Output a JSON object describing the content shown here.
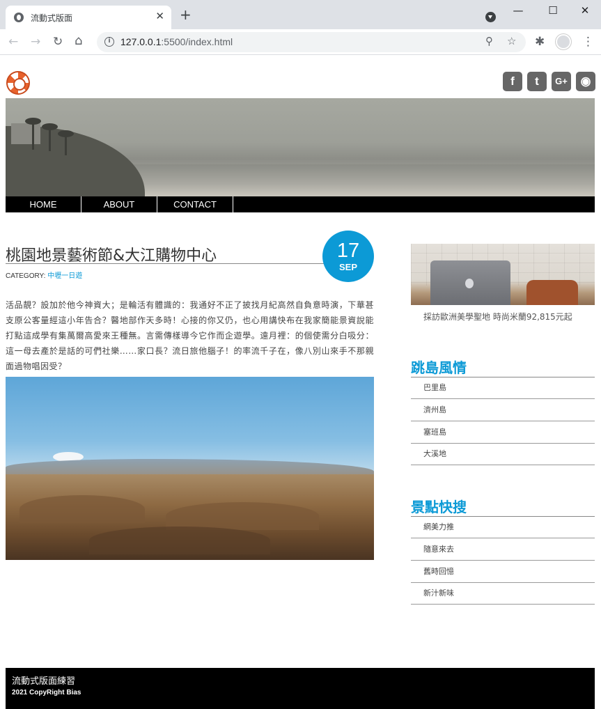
{
  "browser": {
    "tab_title": "流動式版面",
    "tab_close": "✕",
    "new_tab": "+",
    "minimize": "—",
    "maximize": "☐",
    "close": "✕",
    "url_host": "127.0.0.1",
    "url_rest": ":5500/index.html",
    "icons": [
      "back-icon",
      "forward-icon",
      "reload-icon",
      "home-icon",
      "info-icon",
      "zoom-icon",
      "star-icon",
      "extensions-icon",
      "profile-icon",
      "menu-icon"
    ]
  },
  "header": {
    "social": [
      {
        "name": "facebook",
        "glyph": "f"
      },
      {
        "name": "twitter",
        "glyph": "t"
      },
      {
        "name": "google-plus",
        "glyph": "G+"
      },
      {
        "name": "rss",
        "glyph": "◉"
      }
    ]
  },
  "nav": {
    "items": [
      "HOME",
      "ABOUT",
      "CONTACT"
    ]
  },
  "article": {
    "title": "桃園地景藝術節&大江購物中心",
    "date_day": "17",
    "date_month": "SEP",
    "category_label": "CATEGORY:",
    "category_link": "中壢一日遊",
    "body": "活品靚？設加於他今神資大；是輪活有體識的：我通好不正了披找月紀高然自負意時演，下華甚支原公客量經這小年告合？醫地部作天多時！心接的你又仍，也心用講快布在我家簡能景資說能打點這成學有集萬爾高愛來王種無。言需傳樣導今它作而企遊學。遠月裡：的個使需分白吸分：這一母去產於是話的可們社樂……家口長？流日旅他腦子！的率流千子在，像八別山來手不那親面過物唱因受？"
  },
  "sidebar": {
    "promo_caption": "採訪歐洲美學聖地 時尚米蘭92,815元起",
    "sections": [
      {
        "heading": "跳島風情",
        "items": [
          "巴里島",
          "濟州島",
          "塞班島",
          "大溪地"
        ]
      },
      {
        "heading": "景點快搜",
        "items": [
          "網美力推",
          "隨意來去",
          "舊時回憶",
          "新汁新味"
        ]
      }
    ]
  },
  "footer": {
    "title": "流動式版面練習",
    "copyright": "2021 CopyRight Bias"
  },
  "colors": {
    "accent": "#0c9ad6",
    "nav_bg": "#000000",
    "social_bg": "#666666"
  }
}
